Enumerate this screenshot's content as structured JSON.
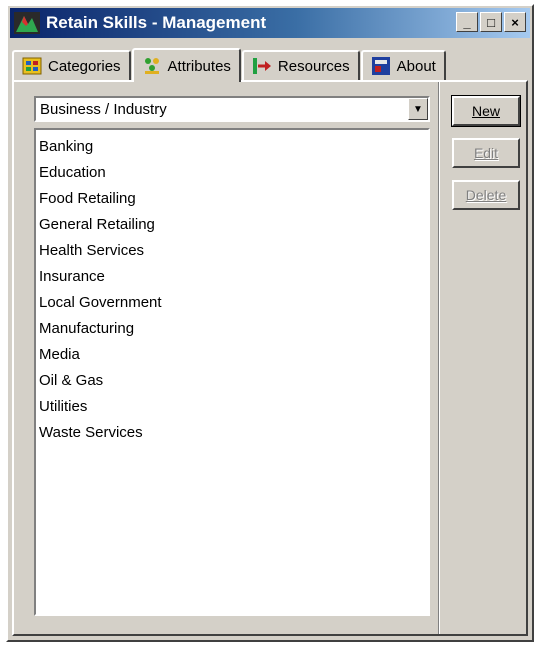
{
  "window": {
    "title": "Retain Skills - Management"
  },
  "titlebar_buttons": {
    "minimize": "_",
    "maximize": "□",
    "close": "×"
  },
  "tabs": [
    {
      "label": "Categories",
      "icon": "categories-icon",
      "active": false
    },
    {
      "label": "Attributes",
      "icon": "attributes-icon",
      "active": true
    },
    {
      "label": "Resources",
      "icon": "resources-icon",
      "active": false
    },
    {
      "label": "About",
      "icon": "about-icon",
      "active": false
    }
  ],
  "attribute_selector": {
    "value": "Business / Industry"
  },
  "attribute_values": [
    "Banking",
    "Education",
    "Food Retailing",
    "General Retailing",
    "Health Services",
    "Insurance",
    "Local Government",
    "Manufacturing",
    "Media",
    "Oil & Gas",
    "Utilities",
    "Waste Services"
  ],
  "buttons": {
    "new": "New",
    "edit": "Edit",
    "delete": "Delete"
  },
  "colors": {
    "face": "#d4d0c8",
    "title_start": "#0a246a",
    "title_end": "#a6caf0"
  }
}
